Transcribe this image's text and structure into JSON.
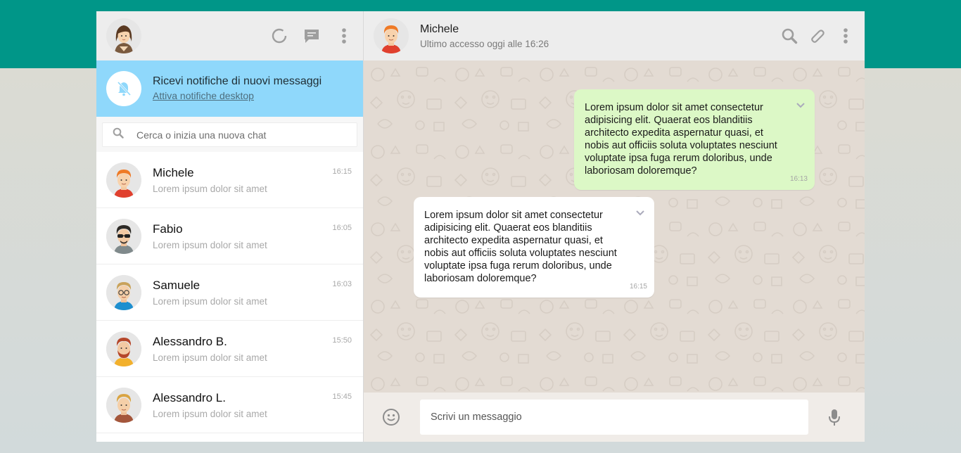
{
  "colors": {
    "brand_band": "#009688",
    "notification_bg": "#8fd8fb",
    "outgoing_bubble": "#dcf8c6",
    "incoming_bubble": "#ffffff",
    "chat_bg": "#e3dbd3"
  },
  "sidebar": {
    "header": {
      "avatar": "user-avatar-woman",
      "icons": [
        "status-icon",
        "new-chat-icon",
        "menu-icon"
      ]
    },
    "notification": {
      "icon": "bell-off-icon",
      "title": "Ricevi notifiche di nuovi messaggi",
      "link": "Attiva notifiche desktop"
    },
    "search": {
      "icon": "search-icon",
      "placeholder": "Cerca o inizia una nuova chat"
    },
    "chats": [
      {
        "name": "Michele",
        "preview": "Lorem ipsum dolor sit amet",
        "time": "16:15",
        "avatar": "avatar-michele"
      },
      {
        "name": "Fabio",
        "preview": "Lorem ipsum dolor sit amet",
        "time": "16:05",
        "avatar": "avatar-fabio"
      },
      {
        "name": "Samuele",
        "preview": "Lorem ipsum dolor sit amet",
        "time": "16:03",
        "avatar": "avatar-samuele"
      },
      {
        "name": "Alessandro B.",
        "preview": "Lorem ipsum dolor sit amet",
        "time": "15:50",
        "avatar": "avatar-alessandro-b"
      },
      {
        "name": "Alessandro L.",
        "preview": "Lorem ipsum dolor sit amet",
        "time": "15:45",
        "avatar": "avatar-alessandro-l"
      }
    ]
  },
  "conversation": {
    "header": {
      "name": "Michele",
      "status": "Ultimo accesso oggi alle 16:26",
      "icons": [
        "search-icon",
        "attach-icon",
        "menu-icon"
      ]
    },
    "messages": [
      {
        "direction": "out",
        "text": "Lorem ipsum dolor sit amet consectetur adipisicing elit. Quaerat eos blanditiis architecto expedita aspernatur quasi, et nobis aut officiis soluta voluptates nesciunt voluptate ipsa fuga rerum doloribus, unde laboriosam doloremque?",
        "time": "16:13"
      },
      {
        "direction": "in",
        "text": "Lorem ipsum dolor sit amet consectetur adipisicing elit. Quaerat eos blanditiis architecto expedita aspernatur quasi, et nobis aut officiis soluta voluptates nesciunt voluptate ipsa fuga rerum doloribus, unde laboriosam doloremque?",
        "time": "16:15"
      }
    ],
    "composer": {
      "emoji_icon": "emoji-icon",
      "placeholder": "Scrivi un messaggio",
      "mic_icon": "microphone-icon"
    }
  }
}
